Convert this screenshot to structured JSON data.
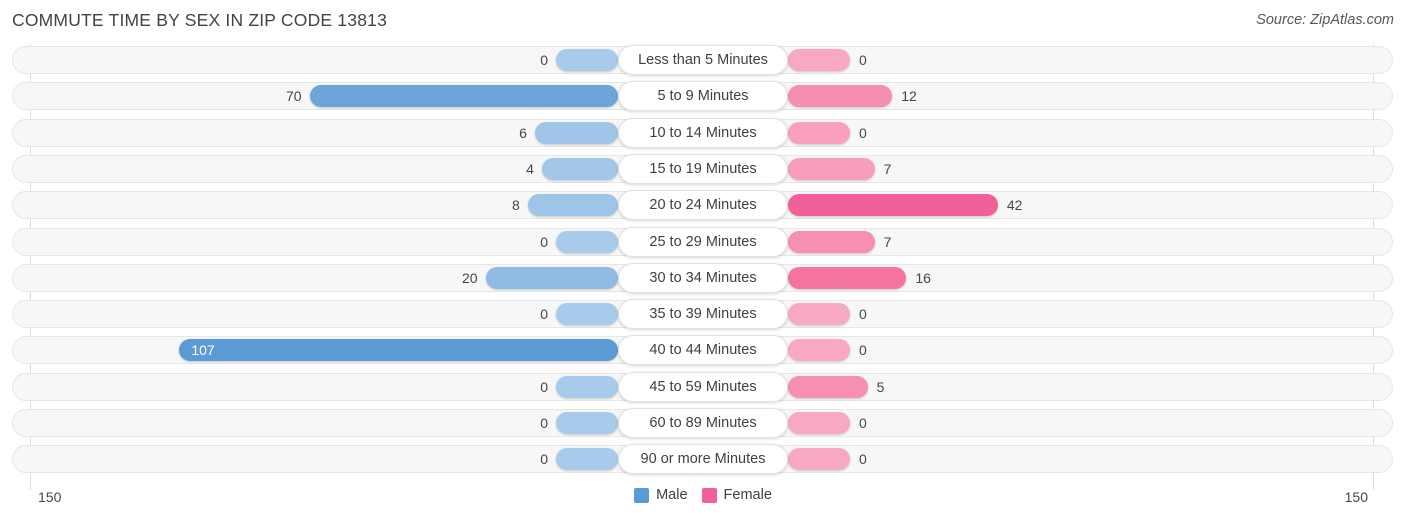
{
  "header": {
    "title": "COMMUTE TIME BY SEX IN ZIP CODE 13813",
    "source": "Source: ZipAtlas.com"
  },
  "legend": {
    "male_label": "Male",
    "female_label": "Female",
    "male_color": "#5b9bd5",
    "female_color": "#f2609a"
  },
  "axis": {
    "left_label": "150",
    "right_label": "150"
  },
  "chart_data": {
    "type": "bar",
    "orientation": "horizontal-diverging",
    "title": "COMMUTE TIME BY SEX IN ZIP CODE 13813",
    "xlabel": "",
    "ylabel": "",
    "xlim": [
      -150,
      150
    ],
    "axis_max": 150,
    "grid": false,
    "legend_position": "bottom-center",
    "categories": [
      "Less than 5 Minutes",
      "5 to 9 Minutes",
      "10 to 14 Minutes",
      "15 to 19 Minutes",
      "20 to 24 Minutes",
      "25 to 29 Minutes",
      "30 to 34 Minutes",
      "35 to 39 Minutes",
      "40 to 44 Minutes",
      "45 to 59 Minutes",
      "60 to 89 Minutes",
      "90 or more Minutes"
    ],
    "series": [
      {
        "name": "Male",
        "values": [
          0,
          70,
          6,
          4,
          8,
          0,
          20,
          0,
          107,
          0,
          0,
          0
        ]
      },
      {
        "name": "Female",
        "values": [
          0,
          12,
          0,
          7,
          42,
          7,
          16,
          0,
          0,
          5,
          0,
          0
        ]
      }
    ]
  },
  "rows": [
    {
      "label": "Less than 5 Minutes",
      "male": "0",
      "female": "0",
      "male_color": "#a8cbeb",
      "female_color": "#f9a8c4"
    },
    {
      "label": "5 to 9 Minutes",
      "male": "70",
      "female": "12",
      "male_color": "#6ba5dc",
      "female_color": "#f78db3"
    },
    {
      "label": "10 to 14 Minutes",
      "male": "6",
      "female": "0",
      "male_color": "#a0c5e8",
      "female_color": "#f9a0c0"
    },
    {
      "label": "15 to 19 Minutes",
      "male": "4",
      "female": "7",
      "male_color": "#a2c7e9",
      "female_color": "#f79dbe"
    },
    {
      "label": "20 to 24 Minutes",
      "male": "8",
      "female": "42",
      "male_color": "#9ec4e7",
      "female_color": "#f2609a"
    },
    {
      "label": "25 to 29 Minutes",
      "male": "0",
      "female": "7",
      "male_color": "#a8cbeb",
      "female_color": "#f78fb4"
    },
    {
      "label": "30 to 34 Minutes",
      "male": "20",
      "female": "16",
      "male_color": "#8fbbe4",
      "female_color": "#f4749f"
    },
    {
      "label": "35 to 39 Minutes",
      "male": "0",
      "female": "0",
      "male_color": "#a8cbeb",
      "female_color": "#f9a8c4"
    },
    {
      "label": "40 to 44 Minutes",
      "male": "107",
      "female": "0",
      "male_color": "#5b9bd5",
      "female_color": "#f9a8c4"
    },
    {
      "label": "45 to 59 Minutes",
      "male": "0",
      "female": "5",
      "male_color": "#a8cbeb",
      "female_color": "#f78eb3"
    },
    {
      "label": "60 to 89 Minutes",
      "male": "0",
      "female": "0",
      "male_color": "#a8cbeb",
      "female_color": "#f9a8c4"
    },
    {
      "label": "90 or more Minutes",
      "male": "0",
      "female": "0",
      "male_color": "#a8cbeb",
      "female_color": "#f9a8c4"
    }
  ]
}
